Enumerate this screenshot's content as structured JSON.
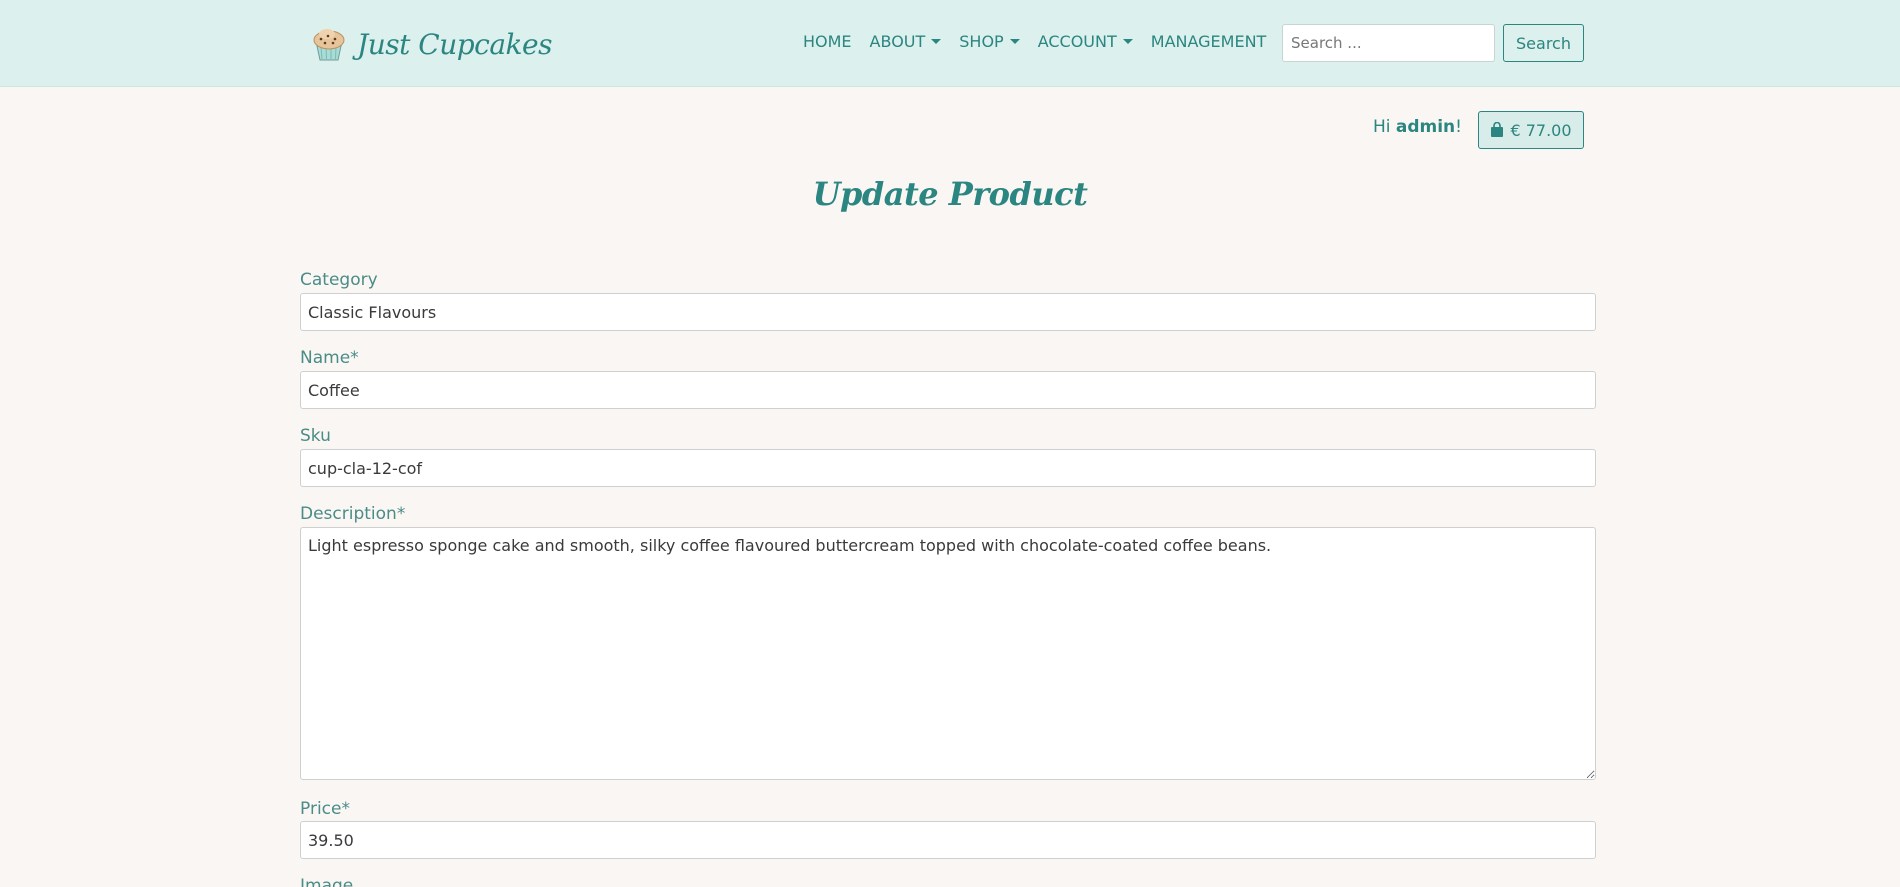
{
  "brand": {
    "name": "Just Cupcakes"
  },
  "nav": {
    "items": [
      {
        "label": "HOME",
        "dropdown": false
      },
      {
        "label": "ABOUT",
        "dropdown": true
      },
      {
        "label": "SHOP",
        "dropdown": true
      },
      {
        "label": "ACCOUNT",
        "dropdown": true
      },
      {
        "label": "MANAGEMENT",
        "dropdown": false
      }
    ],
    "search_placeholder": "Search ...",
    "search_button": "Search"
  },
  "user": {
    "greeting_prefix": "Hi",
    "username": "admin",
    "greeting_suffix": "!"
  },
  "cart": {
    "total": "€ 77.00",
    "icon": "shopping-bag-icon"
  },
  "page": {
    "title": "Update Product"
  },
  "form": {
    "category": {
      "label": "Category",
      "value": "Classic Flavours"
    },
    "name": {
      "label": "Name*",
      "value": "Coffee"
    },
    "sku": {
      "label": "Sku",
      "value": "cup-cla-12-cof"
    },
    "description": {
      "label": "Description*",
      "value": "Light espresso sponge cake and smooth, silky coffee flavoured buttercream topped with chocolate-coated coffee beans."
    },
    "price": {
      "label": "Price*",
      "value": "39.50"
    },
    "image": {
      "label": "Image"
    }
  },
  "colors": {
    "accent": "#2b8580",
    "navbar_bg": "#dcf0ed",
    "page_bg": "#faf6f3"
  }
}
